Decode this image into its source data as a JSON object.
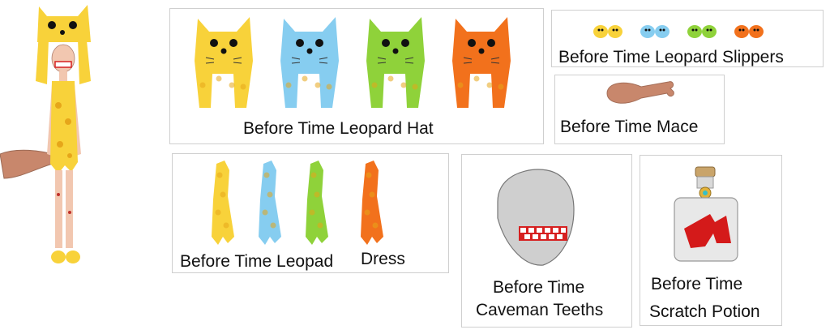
{
  "items": {
    "hat": {
      "label": "Before Time Leopard Hat"
    },
    "slippers": {
      "label": "Before Time Leopard Slippers"
    },
    "mace": {
      "label": "Before Time Mace"
    },
    "dress": {
      "label_part1": "Before Time Leopad",
      "label_part2": "Dress"
    },
    "teeth": {
      "line1": "Before Time",
      "line2": "Caveman Teeths"
    },
    "potion": {
      "line1": "Before Time",
      "line2": "Scratch Potion"
    }
  },
  "variant_colors": [
    "#f8d23a",
    "#86cdf0",
    "#8fd23a",
    "#f2711c"
  ],
  "colors": {
    "spots": "#e6a61a",
    "border": "#cfcfcf",
    "mace": "#c8876c",
    "teeth_red": "#d62020",
    "head_gray": "#cfcfcf",
    "potion_red": "#d41a1a"
  },
  "icons": [
    "character-preview",
    "leopard-hat-icon",
    "leopard-slippers-icon",
    "mace-icon",
    "leopard-dress-icon",
    "caveman-teeth-icon",
    "scratch-potion-icon"
  ]
}
